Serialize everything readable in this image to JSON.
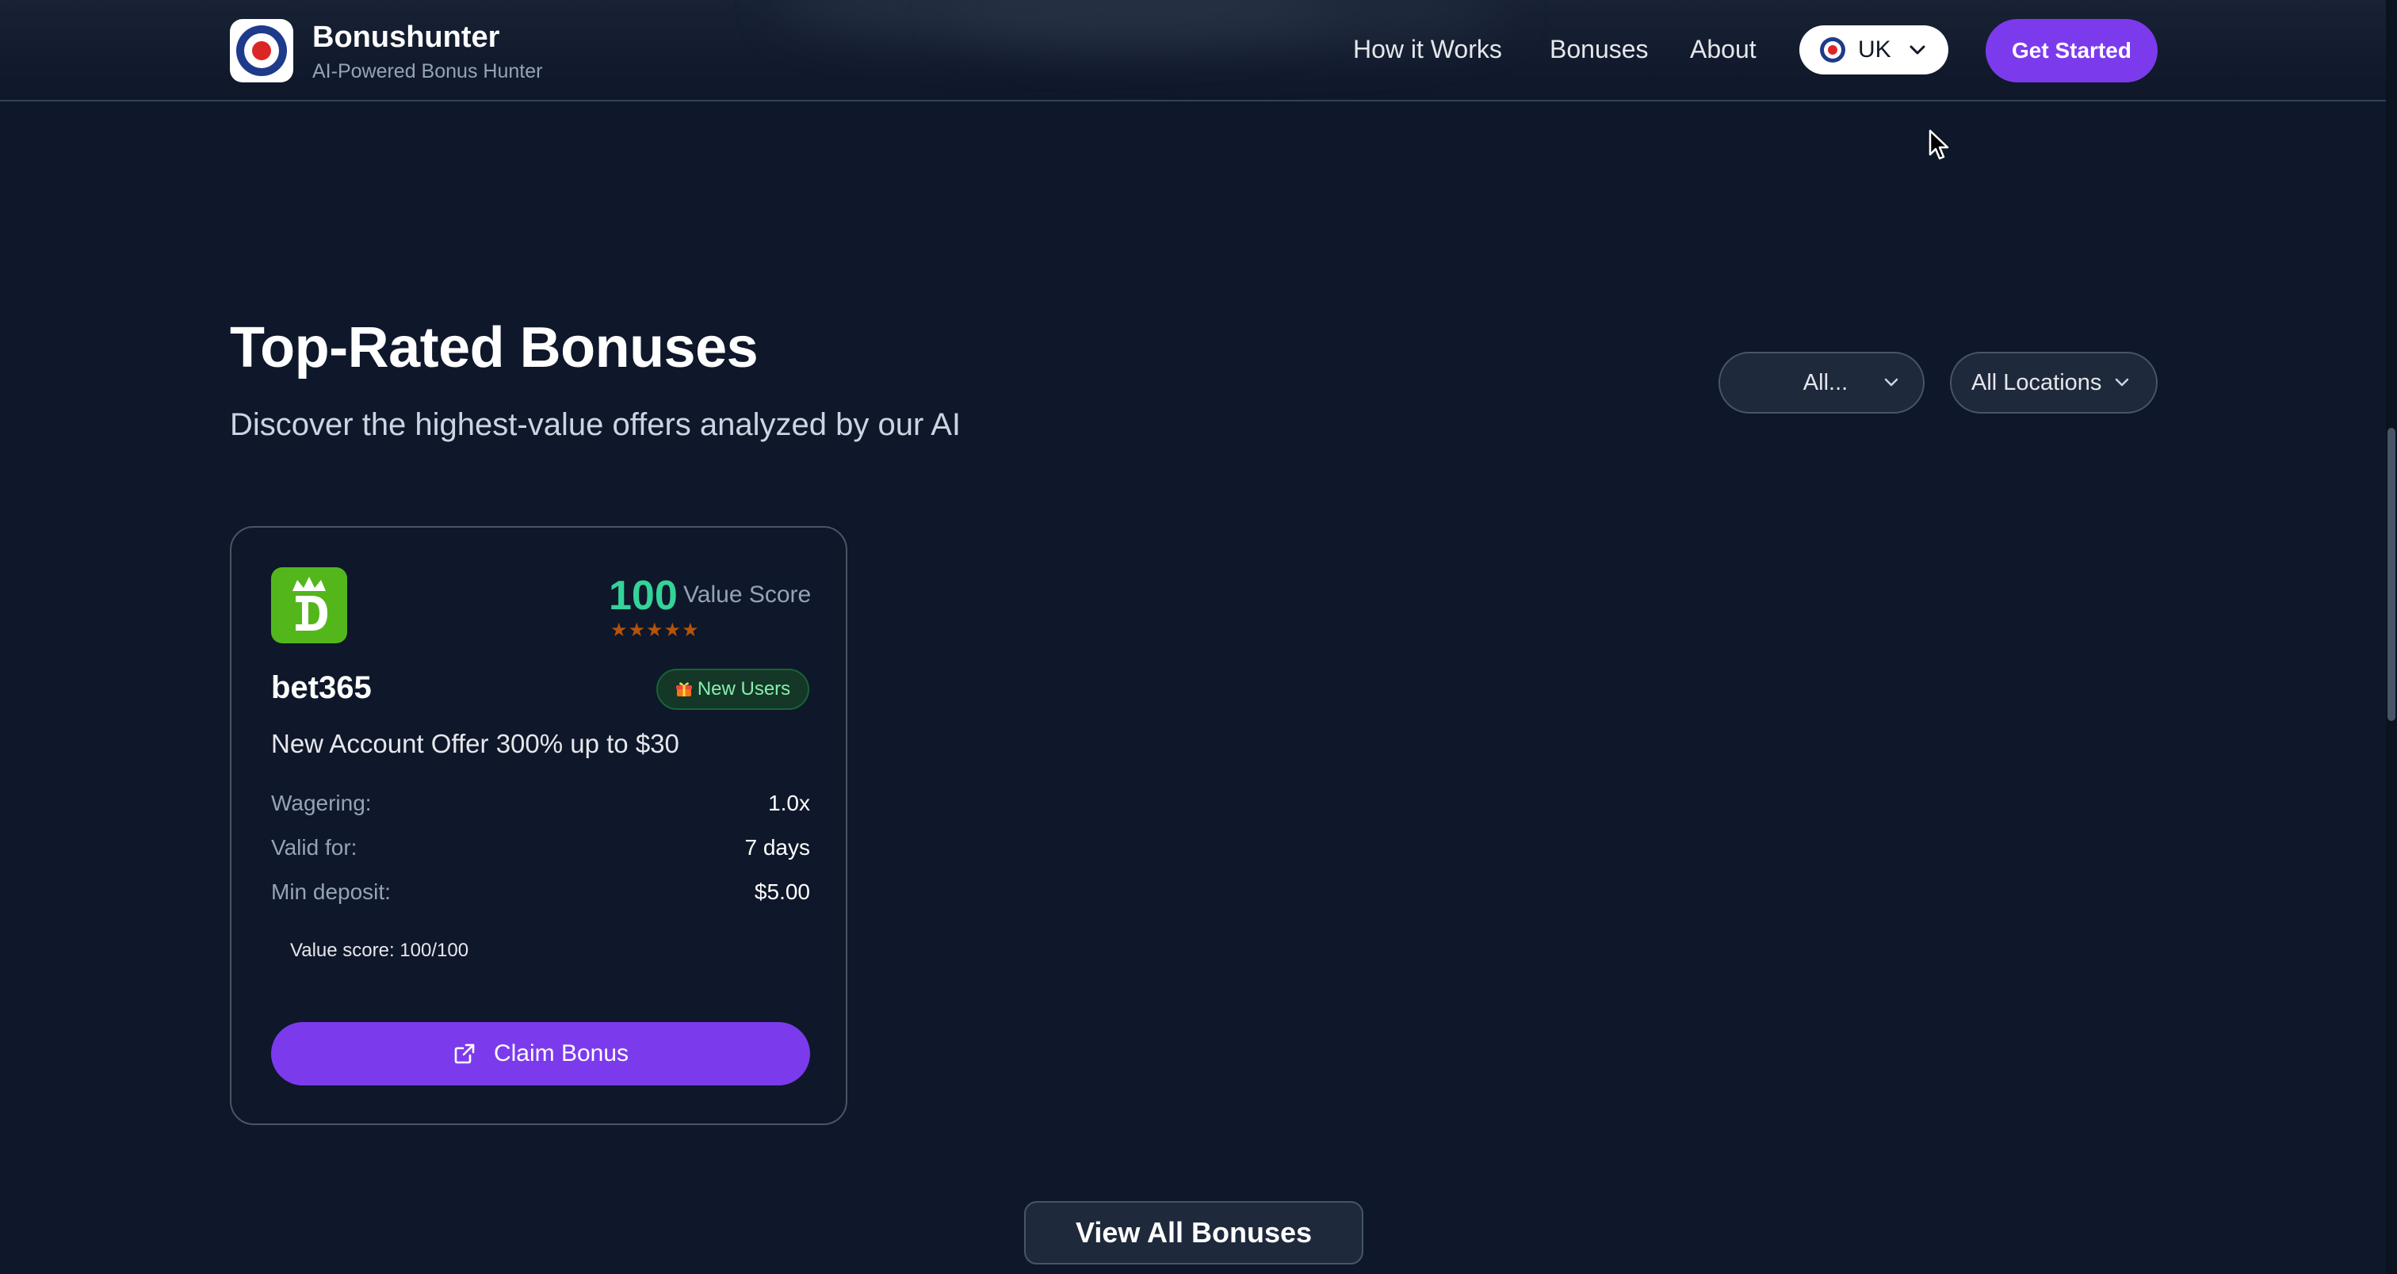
{
  "header": {
    "brand_name": "Bonushunter",
    "brand_tagline": "AI-Powered Bonus Hunter",
    "nav": {
      "how_it_works": "How it Works",
      "bonuses": "Bonuses",
      "about": "About"
    },
    "country": "UK",
    "cta_label": "Get Started"
  },
  "section": {
    "title": "Top-Rated Bonuses",
    "subtitle": "Discover the highest-value offers analyzed by our AI",
    "filters": {
      "category": "All...",
      "location": "All Locations"
    }
  },
  "card": {
    "score": "100",
    "score_label": "Value Score",
    "rating_stars": 5,
    "brand": "bet365",
    "tag": "New Users",
    "offer": "New Account Offer 300% up to $30",
    "details": {
      "wagering_label": "Wagering:",
      "wagering_value": "1.0x",
      "valid_label": "Valid for:",
      "valid_value": "7 days",
      "deposit_label": "Min deposit:",
      "deposit_value": "$5.00"
    },
    "value_note": "Value score: 100/100",
    "claim_label": "Claim Bonus"
  },
  "view_all_label": "View All Bonuses",
  "colors": {
    "background": "#0f172a",
    "accent": "#7c3aed",
    "score": "#34d399",
    "logo_green": "#53b71c"
  }
}
